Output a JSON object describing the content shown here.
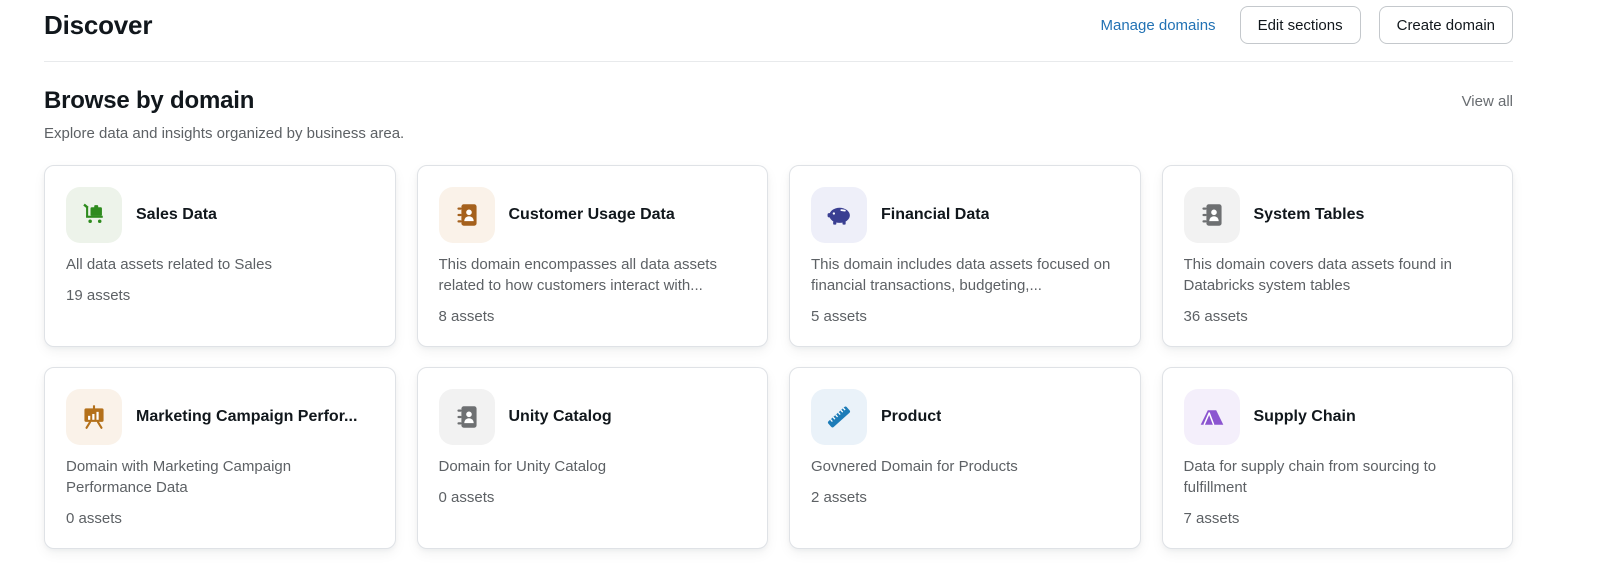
{
  "page": {
    "title": "Discover",
    "actions": {
      "manage_domains": "Manage domains",
      "edit_sections": "Edit sections",
      "create_domain": "Create domain"
    }
  },
  "browse_section": {
    "title": "Browse by domain",
    "subtitle": "Explore data and insights organized by business area.",
    "view_all": "View all"
  },
  "colors": {
    "link_blue": "#2272B4",
    "text_primary": "#11171C",
    "text_secondary": "#5D6165",
    "card_border": "#DFE2E6"
  },
  "cards": [
    {
      "title": "Sales Data",
      "description": "All data assets related to Sales",
      "assets": "19 assets",
      "icon": "luggage-cart-icon",
      "icon_color": "#2E8B1E",
      "icon_bg": "#EDF3EA"
    },
    {
      "title": "Customer Usage Data",
      "description": "This domain encompasses all data assets related to how customers interact with...",
      "assets": "8 assets",
      "icon": "address-book-icon",
      "icon_color": "#A5611D",
      "icon_bg": "#FAF2E9"
    },
    {
      "title": "Financial Data",
      "description": "This domain includes data assets focused on financial transactions, budgeting,...",
      "assets": "5 assets",
      "icon": "piggy-bank-icon",
      "icon_color": "#3A3F92",
      "icon_bg": "#EEEFF9"
    },
    {
      "title": "System Tables",
      "description": "This domain covers data assets found in Databricks system tables",
      "assets": "36 assets",
      "icon": "address-book-icon",
      "icon_color": "#6E7072",
      "icon_bg": "#F2F2F2"
    },
    {
      "title": "Marketing Campaign Perfor...",
      "description": "Domain with Marketing Campaign Performance Data",
      "assets": "0 assets",
      "icon": "presentation-chart-icon",
      "icon_color": "#B4711B",
      "icon_bg": "#FAF2E9"
    },
    {
      "title": "Unity Catalog",
      "description": "Domain for Unity Catalog",
      "assets": "0 assets",
      "icon": "address-book-icon",
      "icon_color": "#6E7072",
      "icon_bg": "#F2F2F2"
    },
    {
      "title": "Product",
      "description": "Govnered Domain for Products",
      "assets": "2 assets",
      "icon": "ruler-icon",
      "icon_color": "#1D7CB8",
      "icon_bg": "#EAF2F9"
    },
    {
      "title": "Supply Chain",
      "description": "Data for supply chain from sourcing to fulfillment",
      "assets": "7 assets",
      "icon": "tent-icon",
      "icon_color": "#8B55D0",
      "icon_bg": "#F4EFFB"
    }
  ]
}
